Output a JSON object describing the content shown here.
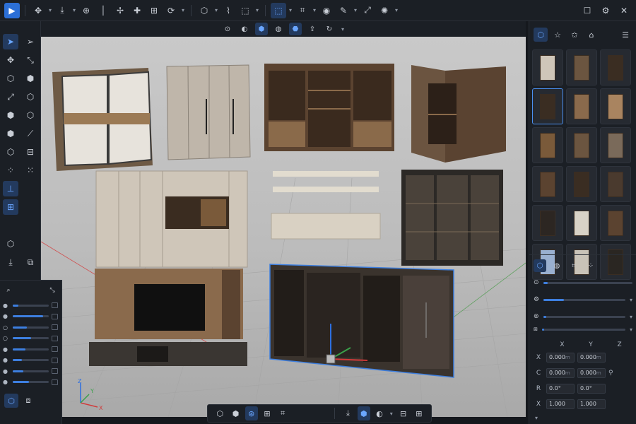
{
  "toolbar": {
    "icons": [
      "play-icon",
      "move-icon",
      "snap-icon",
      "target-icon",
      "line-icon",
      "transform-icon",
      "plus-icon",
      "grid-icon",
      "rotate-icon",
      "cube-icon",
      "curve-icon",
      "select-box-icon",
      "frame-icon",
      "crop-icon",
      "paint-icon",
      "pen-icon",
      "measure-icon",
      "light-icon",
      "square-icon",
      "gear-icon",
      "close-icon"
    ]
  },
  "xyz": {
    "headers": [
      "X",
      "Y",
      "Z"
    ],
    "rows": [
      {
        "key": "X",
        "v1": "0.000",
        "u1": "m",
        "v2": "0.000",
        "u2": "m"
      },
      {
        "key": "C",
        "v1": "0.000",
        "u1": "m",
        "v2": "0.000",
        "u2": "m"
      },
      {
        "key": "R",
        "v1": "0.0°",
        "u1": "",
        "v2": "0.0°",
        "u2": ""
      },
      {
        "key": "X",
        "v1": "1.000",
        "u1": "",
        "v2": "1.000",
        "u2": ""
      }
    ]
  },
  "axis": {
    "x": "X",
    "y": "Y",
    "z": "Z"
  },
  "layers": [
    {
      "level": 0.15,
      "visible": true
    },
    {
      "level": 0.85,
      "visible": true
    },
    {
      "level": 0.4,
      "visible": false
    },
    {
      "level": 0.5,
      "visible": false
    },
    {
      "level": 0.35,
      "visible": true
    },
    {
      "level": 0.25,
      "visible": true
    },
    {
      "level": 0.3,
      "visible": true
    },
    {
      "level": 0.45,
      "visible": true
    }
  ],
  "props_sliders": [
    0.05,
    0.25,
    0.04,
    0.03
  ],
  "accent": "#3d7fe0"
}
